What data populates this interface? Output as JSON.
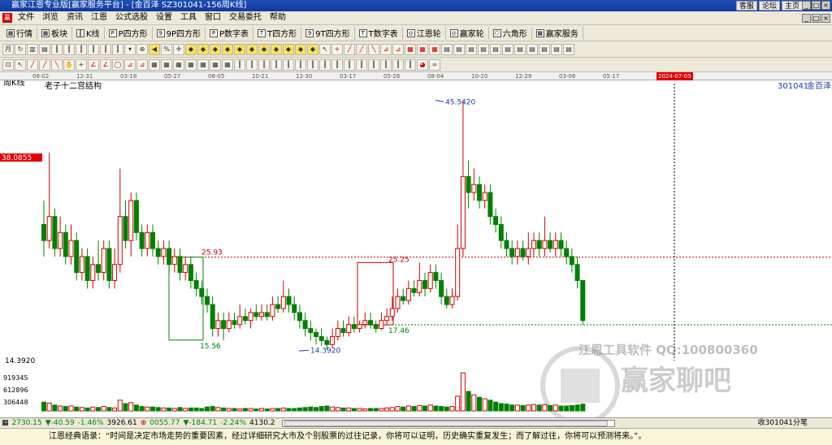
{
  "window": {
    "title": "赢家江恩专业版[赢家服务平台] - [金百泽  SZ301041-156周K线]",
    "links": [
      "客服",
      "论坛",
      "主页"
    ]
  },
  "menu": [
    "文件",
    "浏览",
    "资讯",
    "江恩",
    "公式选股",
    "设置",
    "工具",
    "窗口",
    "交易委托",
    "帮助"
  ],
  "toolbar": [
    "行情",
    "板块",
    "K线",
    "P四方形",
    "9P四方形",
    "P数字表",
    "T四方形",
    "9T四方形",
    "T数字表",
    "江恩轮",
    "赢家轮",
    "六角形",
    "赢家服务"
  ],
  "chart_data": {
    "type": "candlestick",
    "period_label": "周K线",
    "study_label": "老子十二宫结构",
    "symbol_code": "301041",
    "symbol_name": "金百泽",
    "time_ticks": [
      "08-02",
      "12-31",
      "03-18",
      "05-27",
      "08-05",
      "10-21",
      "12-30",
      "03-17",
      "05-26",
      "08-04",
      "10-20",
      "12-29",
      "03-08",
      "05-17"
    ],
    "cursor_date": "2024-07-05",
    "y_axis_tag": "38.0855",
    "levels": [
      25.93,
      17.46,
      14.392
    ],
    "level_labels": [
      "25.93",
      "17.46",
      "25.25",
      "15.56"
    ],
    "high_label": "45.5420",
    "low_label": "14.3920",
    "bottom_price": "14.3920",
    "volume_ticks": [
      "919345",
      "612896",
      "306448"
    ],
    "price_range": [
      13.0,
      47.0
    ],
    "candles": [
      [
        30,
        28,
        33,
        26
      ],
      [
        28,
        31,
        39,
        27
      ],
      [
        31,
        27,
        32,
        26
      ],
      [
        27,
        29,
        31,
        26
      ],
      [
        29,
        26,
        30,
        25
      ],
      [
        26,
        28,
        30,
        25
      ],
      [
        28,
        24,
        29,
        23
      ],
      [
        24,
        26,
        27,
        23
      ],
      [
        26,
        23,
        27,
        22
      ],
      [
        23,
        25,
        26,
        22
      ],
      [
        25,
        24,
        28,
        23
      ],
      [
        24,
        27,
        28,
        23
      ],
      [
        27,
        23,
        28,
        22
      ],
      [
        23,
        25,
        27,
        22
      ],
      [
        25,
        31,
        37,
        24
      ],
      [
        31,
        28,
        33,
        27
      ],
      [
        28,
        33,
        34,
        26
      ],
      [
        33,
        29,
        34,
        28
      ],
      [
        29,
        27,
        30,
        26
      ],
      [
        27,
        29,
        30,
        26
      ],
      [
        29,
        27,
        30,
        26
      ],
      [
        27,
        26,
        28,
        25
      ],
      [
        26,
        27,
        28,
        25
      ],
      [
        27,
        25,
        28,
        24
      ],
      [
        25,
        26,
        27,
        24
      ],
      [
        26,
        24,
        27,
        23
      ],
      [
        24,
        25,
        26,
        23
      ],
      [
        25,
        23,
        26,
        22
      ],
      [
        23,
        22,
        24,
        21
      ],
      [
        22,
        21,
        23,
        20
      ],
      [
        21,
        20,
        22,
        19
      ],
      [
        20,
        17,
        21,
        16
      ],
      [
        17,
        18,
        19,
        16
      ],
      [
        18,
        17,
        19,
        15.56
      ],
      [
        17,
        18,
        19,
        16.5
      ],
      [
        18,
        17.5,
        19,
        17
      ],
      [
        17.5,
        18.5,
        20,
        17
      ],
      [
        18.5,
        18,
        19.5,
        17.5
      ],
      [
        18,
        19,
        19.5,
        17
      ],
      [
        19,
        18.5,
        20,
        18
      ],
      [
        18.5,
        19,
        20,
        18
      ],
      [
        19,
        18.5,
        20,
        18
      ],
      [
        18.5,
        20,
        21,
        18
      ],
      [
        20,
        19.5,
        21,
        19
      ],
      [
        19.5,
        21,
        23,
        19
      ],
      [
        21,
        20,
        22,
        19
      ],
      [
        20,
        19,
        21,
        18
      ],
      [
        19,
        18,
        20,
        17
      ],
      [
        18,
        17,
        19,
        16
      ],
      [
        17,
        16.5,
        18,
        15.5
      ],
      [
        16.5,
        16,
        17,
        15
      ],
      [
        16,
        15.5,
        17,
        14.8
      ],
      [
        15.5,
        15,
        16,
        14.39
      ],
      [
        15,
        16,
        17,
        14.6
      ],
      [
        16,
        17,
        18,
        15.5
      ],
      [
        17,
        16.5,
        18,
        16
      ],
      [
        16.5,
        17.5,
        18.5,
        16
      ],
      [
        17.5,
        17,
        18.5,
        16.5
      ],
      [
        17,
        17.5,
        18,
        16.5
      ],
      [
        17.5,
        18,
        19,
        17
      ],
      [
        18,
        17.5,
        19,
        17
      ],
      [
        17.5,
        17,
        18,
        16.5
      ],
      [
        17,
        18,
        19,
        16.8
      ],
      [
        18,
        18.5,
        19.5,
        17.5
      ],
      [
        18.5,
        19.5,
        21,
        18
      ],
      [
        19.5,
        21,
        22,
        19
      ],
      [
        21,
        20.5,
        22,
        20
      ],
      [
        20.5,
        22,
        23,
        20
      ],
      [
        22,
        21.5,
        23,
        21
      ],
      [
        21.5,
        23,
        25.25,
        21
      ],
      [
        23,
        22,
        24,
        21
      ],
      [
        22,
        24,
        25,
        21.5
      ],
      [
        24,
        23,
        25,
        22
      ],
      [
        23,
        21,
        24,
        20
      ],
      [
        21,
        20,
        22,
        19.5
      ],
      [
        20,
        21,
        22,
        19.5
      ],
      [
        21,
        27,
        30,
        20.5
      ],
      [
        27,
        36,
        45.542,
        26
      ],
      [
        36,
        34,
        38,
        32
      ],
      [
        34,
        35,
        37,
        33
      ],
      [
        35,
        33,
        36,
        32
      ],
      [
        33,
        34,
        35,
        32
      ],
      [
        34,
        31,
        35,
        30
      ],
      [
        31,
        30,
        32,
        29
      ],
      [
        30,
        28,
        31,
        27
      ],
      [
        28,
        27,
        29,
        26
      ],
      [
        27,
        26,
        28,
        25
      ],
      [
        26,
        27,
        28,
        25
      ],
      [
        27,
        26,
        28,
        25.5
      ],
      [
        26,
        27,
        29,
        25
      ],
      [
        27,
        28,
        29,
        26
      ],
      [
        28,
        27,
        29,
        26
      ],
      [
        27,
        28,
        31,
        26
      ],
      [
        28,
        27,
        29,
        26.5
      ],
      [
        27,
        28,
        29,
        26
      ],
      [
        28,
        27,
        29,
        26
      ],
      [
        27,
        26,
        28,
        25
      ],
      [
        26,
        25,
        27,
        24
      ],
      [
        25,
        23,
        26,
        22
      ],
      [
        23,
        18,
        23,
        17.46
      ]
    ],
    "volumes": [
      0.18,
      0.16,
      0.12,
      0.1,
      0.09,
      0.1,
      0.08,
      0.07,
      0.06,
      0.08,
      0.07,
      0.09,
      0.07,
      0.06,
      0.22,
      0.15,
      0.17,
      0.12,
      0.09,
      0.08,
      0.08,
      0.07,
      0.06,
      0.06,
      0.05,
      0.07,
      0.05,
      0.06,
      0.06,
      0.05,
      0.08,
      0.09,
      0.07,
      0.06,
      0.05,
      0.05,
      0.04,
      0.05,
      0.05,
      0.04,
      0.05,
      0.04,
      0.05,
      0.05,
      0.06,
      0.05,
      0.05,
      0.06,
      0.07,
      0.08,
      0.07,
      0.09,
      0.1,
      0.08,
      0.07,
      0.06,
      0.06,
      0.05,
      0.05,
      0.04,
      0.05,
      0.05,
      0.05,
      0.06,
      0.07,
      0.09,
      0.08,
      0.1,
      0.09,
      0.11,
      0.1,
      0.12,
      0.1,
      0.09,
      0.08,
      0.09,
      0.3,
      0.78,
      0.4,
      0.33,
      0.28,
      0.25,
      0.22,
      0.18,
      0.15,
      0.14,
      0.12,
      0.12,
      0.11,
      0.12,
      0.13,
      0.12,
      0.13,
      0.11,
      0.12,
      0.1,
      0.1,
      0.11,
      0.12,
      0.14
    ],
    "up_color": "#d00000",
    "down_color": "#008000"
  },
  "watermark": {
    "tools": "江恩工具软件  QQ:100800360",
    "brand": "赢家聊吧"
  },
  "status": {
    "sh_index": "2730.15",
    "sh_change": "▼-40.59",
    "sh_pct": "-1.46%",
    "sh_amount": "3926.61",
    "sz_index": "0055.77",
    "sz_change": "▼-184.71",
    "sz_pct": "-2.24%",
    "sz_amount": "4130.2",
    "right_info": "收301041分笔"
  },
  "quote": "江恩经典语录：“时间是决定市场走势的重要因素，经过详细研究大市及个别股票的过往记录，你将可以证明，历史确实重复发生；而了解过往，你将可以预测将来。”。"
}
